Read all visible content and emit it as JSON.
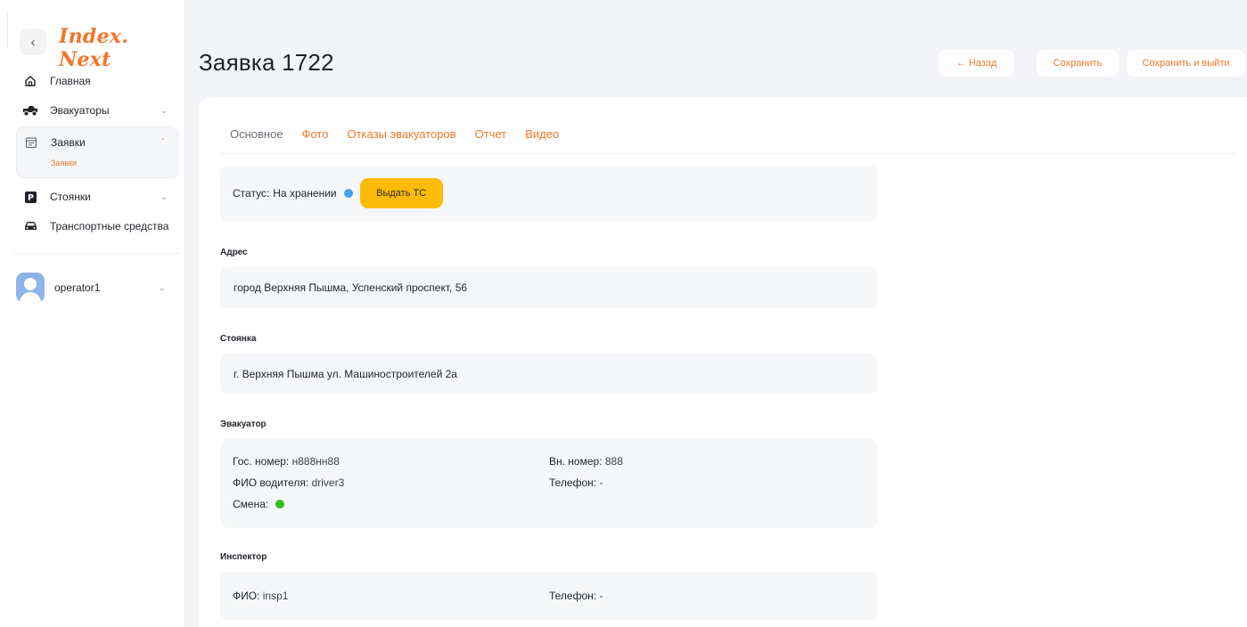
{
  "sidebar": {
    "logo": "Index. Next",
    "collapse_icon": "chevron-left-icon",
    "items": [
      {
        "label": "Главная",
        "icon": "home-icon"
      },
      {
        "label": "Эвакуаторы",
        "icon": "tow-truck-icon"
      },
      {
        "label": "Заявки",
        "icon": "calendar-icon",
        "sub": [
          "Заявки"
        ]
      },
      {
        "label": "Стоянки",
        "icon": "parking-icon"
      },
      {
        "label": "Транспортные средства",
        "icon": "car-icon"
      }
    ],
    "user": {
      "name": "operator1"
    }
  },
  "header": {
    "title": "Заявка 1722",
    "back_label": "← Назад",
    "save_label": "Сохранить",
    "save_exit_label": "Сохранить и выйти"
  },
  "tabs": [
    "Основное",
    "Фото",
    "Отказы эвакуаторов",
    "Отчет",
    "Видео"
  ],
  "status": {
    "label": "Статус:",
    "value": "На хранении",
    "button": "Выдать ТС"
  },
  "address": {
    "title": "Адрес",
    "value": "город Верхняя Пышма, Успенский проспект, 56"
  },
  "parking": {
    "title": "Стоянка",
    "value": "г. Верхняя Пышма ул. Машиностроителей 2а"
  },
  "tow_truck": {
    "title": "Эвакуатор",
    "plate_label": "Гос. номер:",
    "plate": "н888нн88",
    "internal_label": "Вн. номер:",
    "internal": "888",
    "driver_label": "ФИО водителя:",
    "driver": "driver3",
    "phone_label": "Телефон:",
    "phone": "-",
    "shift_label": "Смена:"
  },
  "inspector": {
    "title": "Инспектор",
    "name_label": "ФИО:",
    "name": "insp1",
    "phone_label": "Телефон:",
    "phone": "-"
  },
  "colors": {
    "accent": "#f2772b",
    "status_button": "#fcbb08",
    "status_dot": "#4aa3e8",
    "shift_dot": "#2ec21e"
  }
}
